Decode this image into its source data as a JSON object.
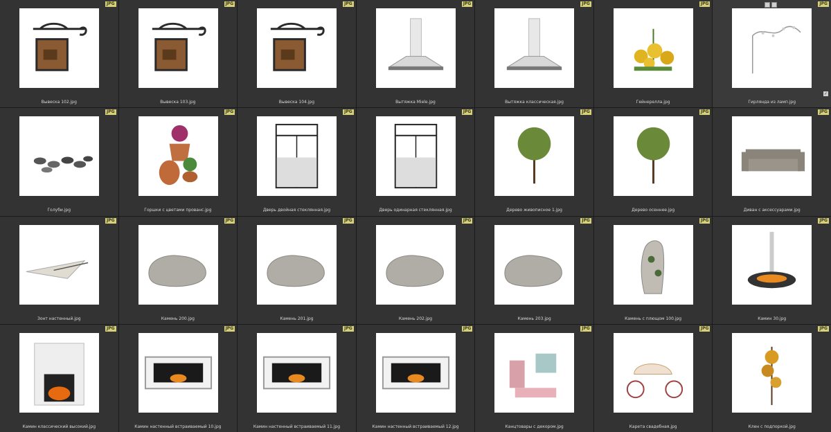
{
  "badge_label": "JPG",
  "items": [
    {
      "name": "Вывеска 102.jpg",
      "icon": "sign-icon"
    },
    {
      "name": "Вывеска 103.jpg",
      "icon": "sign-icon"
    },
    {
      "name": "Вывеска 104.jpg",
      "icon": "sign-icon"
    },
    {
      "name": "Вытяжка Miele.jpg",
      "icon": "hood-icon"
    },
    {
      "name": "Вытяжка классическая.jpg",
      "icon": "hood-icon"
    },
    {
      "name": "Гейнерелла.jpg",
      "icon": "flower-icon"
    },
    {
      "name": "Гирлянда из ламп.jpg",
      "icon": "garland-icon"
    },
    {
      "name": "Голуби.jpg",
      "icon": "pigeons-icon"
    },
    {
      "name": "Горшки с цветами прованс.jpg",
      "icon": "pots-icon"
    },
    {
      "name": "Дверь двойная стеклянная.jpg",
      "icon": "door-icon"
    },
    {
      "name": "Дверь одинарная стеклянная.jpg",
      "icon": "door-icon"
    },
    {
      "name": "Дерево живописное 1.jpg",
      "icon": "tree-icon"
    },
    {
      "name": "Дерево осеннее.jpg",
      "icon": "tree-icon"
    },
    {
      "name": "Диван с аксессуарами.jpg",
      "icon": "sofa-icon"
    },
    {
      "name": "Зонт настенный.jpg",
      "icon": "umbrella-icon"
    },
    {
      "name": "Камень 200.jpg",
      "icon": "stone-icon"
    },
    {
      "name": "Камень 201.jpg",
      "icon": "stone-icon"
    },
    {
      "name": "Камень 202.jpg",
      "icon": "stone-icon"
    },
    {
      "name": "Камень 203.jpg",
      "icon": "stone-icon"
    },
    {
      "name": "Камень с плющом 100.jpg",
      "icon": "stone-ivy-icon"
    },
    {
      "name": "Камин 30.jpg",
      "icon": "fireplace-round-icon"
    },
    {
      "name": "Камин классический высокий.jpg",
      "icon": "fireplace-classic-icon"
    },
    {
      "name": "Камин настенный встраиваемый 10.jpg",
      "icon": "fireplace-wall-icon"
    },
    {
      "name": "Камин настенный встраиваемый 11.jpg",
      "icon": "fireplace-wall-icon"
    },
    {
      "name": "Камин настенный встраиваемый 12.jpg",
      "icon": "fireplace-wall-icon"
    },
    {
      "name": "Канцтовары с декором.jpg",
      "icon": "stationery-icon"
    },
    {
      "name": "Карета свадебная.jpg",
      "icon": "carriage-icon"
    },
    {
      "name": "Клен с подпоркой.jpg",
      "icon": "maple-icon"
    }
  ]
}
